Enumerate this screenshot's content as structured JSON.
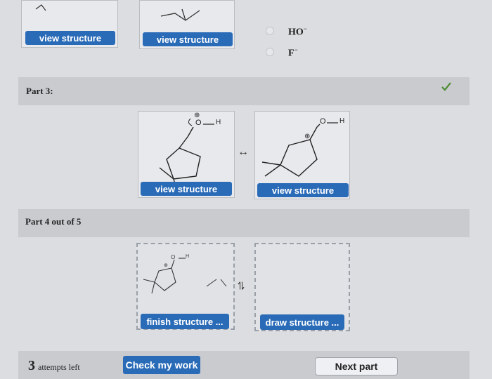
{
  "top_row": {
    "view_structure_1": "view structure",
    "view_structure_2": "view structure",
    "options": [
      {
        "label_base": "HO",
        "label_sup": "−"
      },
      {
        "label_base": "F",
        "label_sup": "−"
      }
    ]
  },
  "part3": {
    "label": "Part 3:",
    "structure_a": {
      "button": "view structure",
      "oh_label": "O",
      "h_label": "H",
      "charge": "⊕"
    },
    "arrow": "↔",
    "structure_b": {
      "button": "view structure",
      "oh_label": "O",
      "h_label": "H",
      "charge": "⊕"
    }
  },
  "part4": {
    "label": "Part 4 out of 5",
    "structure_a": {
      "button": "finish structure ...",
      "o_label": "O",
      "h_label": "H",
      "charge": "⊕"
    },
    "equilibrium_symbol": "⇌",
    "structure_b": {
      "button": "draw structure ..."
    }
  },
  "footer": {
    "attempts_count": "3",
    "attempts_text": "attempts left",
    "check_button": "Check my work",
    "next_button": "Next part"
  },
  "colors": {
    "button_blue": "#2a6bb8",
    "check_green": "#4a8a2a"
  }
}
